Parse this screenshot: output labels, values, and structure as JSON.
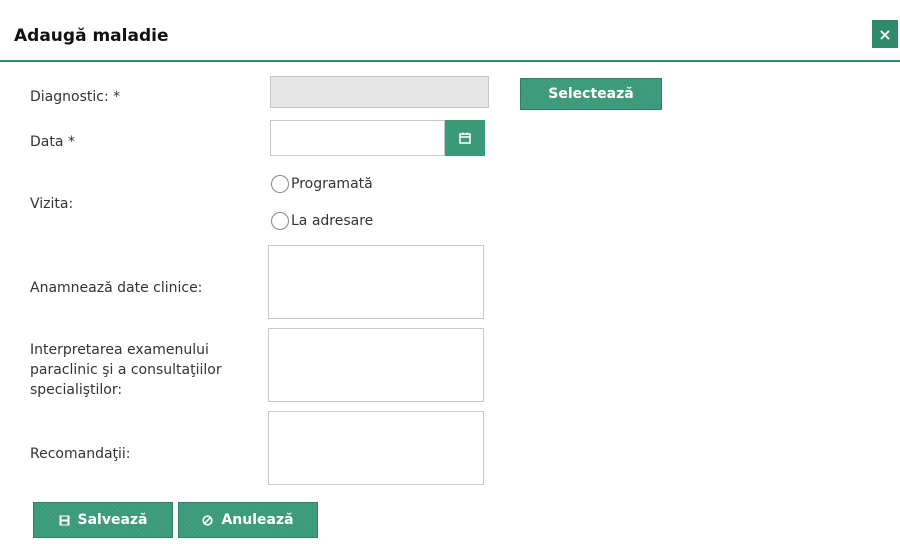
{
  "dialog": {
    "title": "Adaugă maladie",
    "close_symbol": "×"
  },
  "form": {
    "diagnostic_label": "Diagnostic: *",
    "diagnostic_value": "",
    "select_button": "Selectează",
    "date_label": "Data *",
    "date_value": "",
    "visit_label": "Vizita:",
    "visit_options": [
      "Programată",
      "La adresare"
    ],
    "anamnesis_label": "Anamnează date clinice:",
    "interpretation_label": "Interpretarea examenului paraclinic şi a consultaţiilor specialiştilor:",
    "recommendations_label": "Recomandaţii:"
  },
  "actions": {
    "save_label": "Salvează",
    "cancel_label": "Anulează"
  },
  "icons": {
    "close": "close-icon",
    "calendar": "calendar-icon",
    "save": "save-icon",
    "cancel": "cancel-icon"
  },
  "colors": {
    "accent": "#3a9a78",
    "header_border": "#2e8a6b",
    "disabled_field": "#e5e5e5"
  }
}
